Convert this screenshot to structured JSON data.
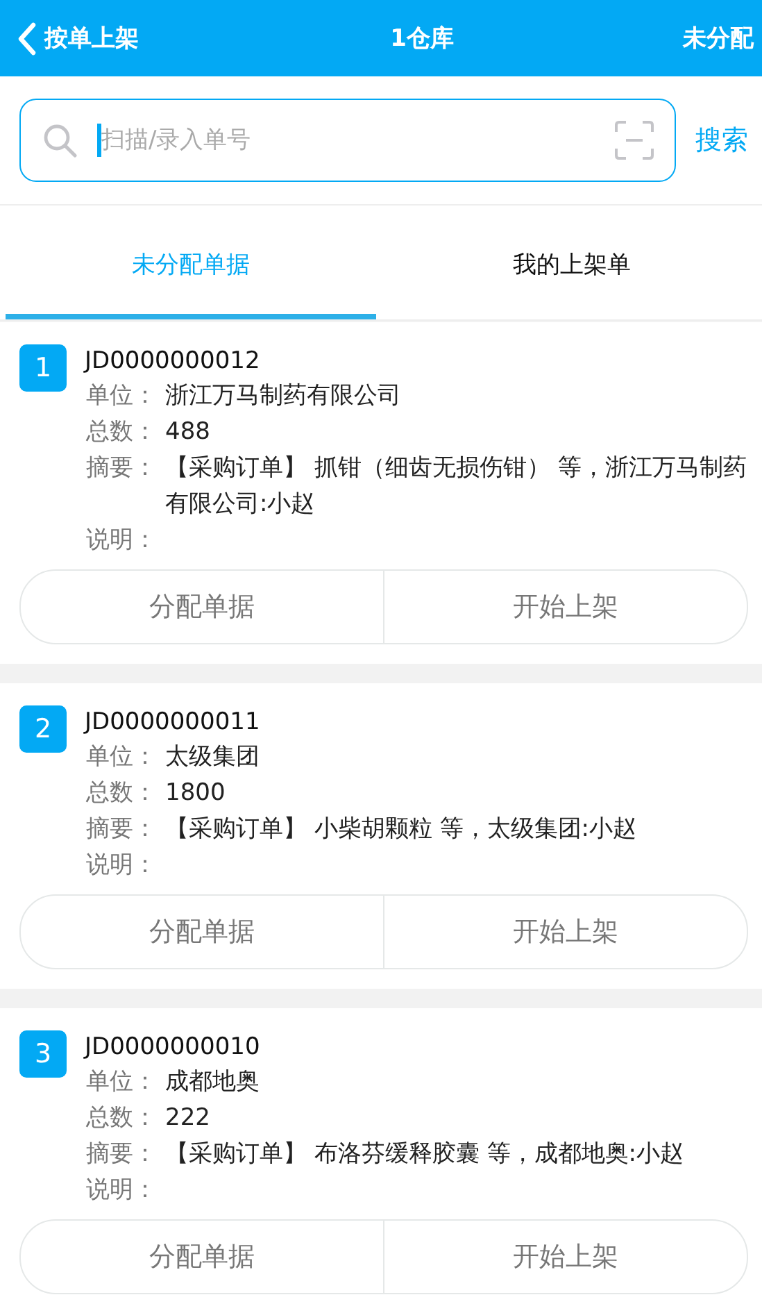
{
  "header": {
    "back_label": "按单上架",
    "title": "1仓库",
    "action": "未分配"
  },
  "search": {
    "placeholder": "扫描/录入单号",
    "button": "搜索"
  },
  "tabs": [
    {
      "label": "未分配单据",
      "selected": true
    },
    {
      "label": "我的上架单",
      "selected": false
    }
  ],
  "orders": [
    {
      "index": "1",
      "number": "JD0000000012",
      "fields": [
        {
          "label": "单位：",
          "value": "浙江万马制药有限公司"
        },
        {
          "label": "总数：",
          "value": "488"
        },
        {
          "label": "摘要：",
          "value": "【采购订单】 抓钳（细齿无损伤钳） 等，浙江万马制药有限公司:小赵"
        },
        {
          "label": "说明："
        }
      ],
      "buttons": [
        "分配单据",
        "开始上架"
      ]
    },
    {
      "index": "2",
      "number": "JD0000000011",
      "fields": [
        {
          "label": "单位：",
          "value": "太级集团"
        },
        {
          "label": "总数：",
          "value": "1800"
        },
        {
          "label": "摘要：",
          "value": "【采购订单】 小柴胡颗粒 等，太级集团:小赵"
        },
        {
          "label": "说明："
        }
      ],
      "buttons": [
        "分配单据",
        "开始上架"
      ]
    },
    {
      "index": "3",
      "number": "JD0000000010",
      "fields": [
        {
          "label": "单位：",
          "value": "成都地奥"
        },
        {
          "label": "总数：",
          "value": "222"
        },
        {
          "label": "摘要：",
          "value": "【采购订单】 布洛芬缓释胶囊 等，成都地奥:小赵"
        },
        {
          "label": "说明："
        }
      ],
      "buttons": [
        "分配单据",
        "开始上架"
      ]
    }
  ]
}
